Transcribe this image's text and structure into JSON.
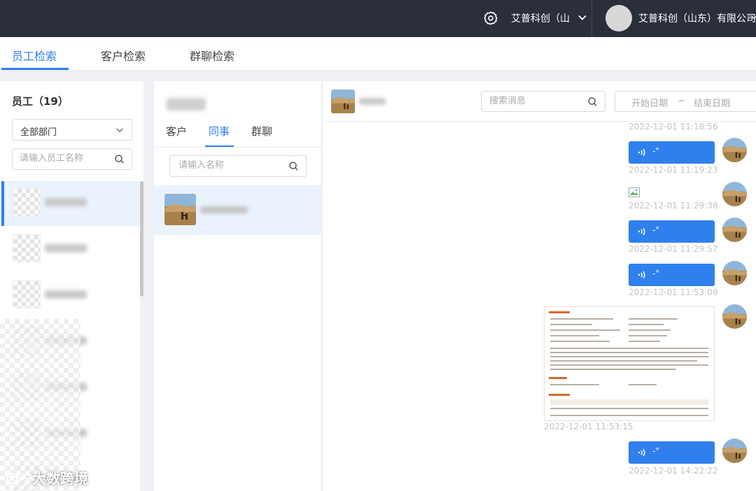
{
  "topbar": {
    "company_label": "艾普科创（山",
    "user_company": "艾普科创（山东）有限公司"
  },
  "main_tabs": [
    {
      "label": "员工检索"
    },
    {
      "label": "客户检索"
    },
    {
      "label": "群聊检索"
    }
  ],
  "employee_panel": {
    "title": "员工（19）",
    "department_select": "全部部门",
    "search_placeholder": "请输入员工名称"
  },
  "contact_panel": {
    "tabs": [
      {
        "label": "客户"
      },
      {
        "label": "同事"
      },
      {
        "label": "群聊"
      }
    ],
    "active_tab": "同事",
    "search_placeholder": "请输入名称"
  },
  "chat_panel": {
    "search_placeholder": "搜索消息",
    "date_start_placeholder": "开始日期",
    "date_separator": "~",
    "date_end_placeholder": "结束日期",
    "messages": [
      {
        "type": "time",
        "time": "2022-12-01 11:18:56"
      },
      {
        "type": "voice",
        "duration": "-\"",
        "time": "2022-12-01 11:19:23"
      },
      {
        "type": "image-broken",
        "time": "2022-12-01 11:29:38"
      },
      {
        "type": "voice",
        "duration": "-\"",
        "time": "2022-12-01 11:29:57"
      },
      {
        "type": "voice",
        "duration": "-\"",
        "time": "2022-12-01 11:53:08"
      },
      {
        "type": "image-document",
        "time": "2022-12-01 11:53:15"
      },
      {
        "type": "voice",
        "duration": "-\"",
        "time": "2022-12-01 14:22:22"
      }
    ]
  },
  "watermark": "大数跨境",
  "colors": {
    "topbar_bg": "#2b2f3a",
    "accent": "#2f80ed",
    "selected_bg": "#eaf3fd",
    "timestamp": "#c4c4c4"
  },
  "icons": [
    "gear-icon",
    "chevron-down-icon",
    "search-icon",
    "voice-wave-icon",
    "broken-image-icon"
  ]
}
